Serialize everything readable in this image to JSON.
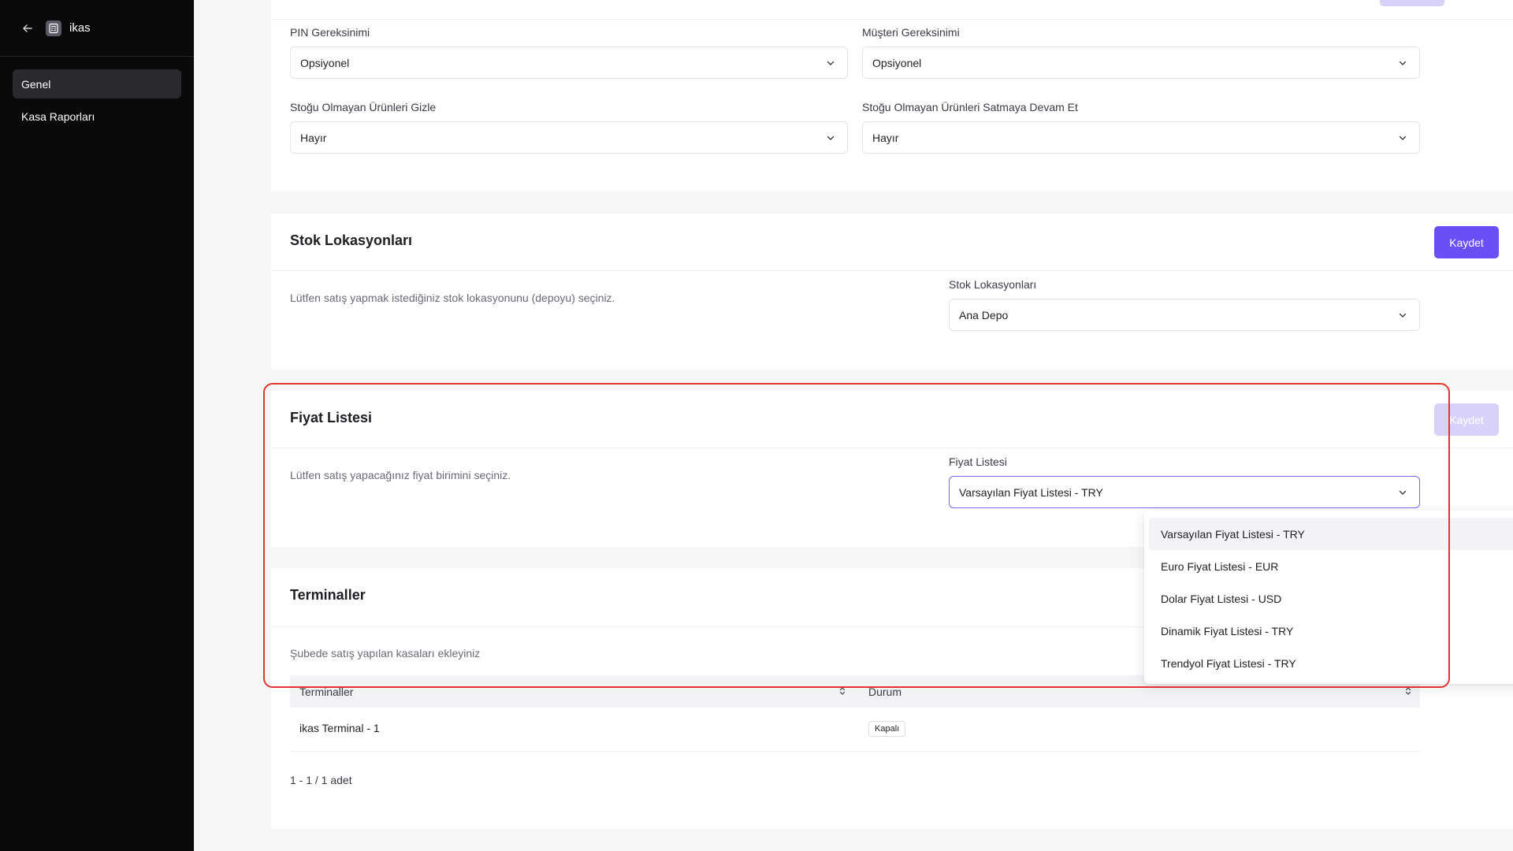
{
  "app": {
    "name": "ikas"
  },
  "sidebar": {
    "items": [
      {
        "label": "Genel",
        "active": true
      },
      {
        "label": "Kasa Raporları",
        "active": false
      }
    ]
  },
  "settings": {
    "pin": {
      "label": "PIN Gereksinimi",
      "value": "Opsiyonel"
    },
    "customer": {
      "label": "Müşteri Gereksinimi",
      "value": "Opsiyonel"
    },
    "hide_out_of_stock": {
      "label": "Stoğu Olmayan Ürünleri Gizle",
      "value": "Hayır"
    },
    "sell_out_of_stock": {
      "label": "Stoğu Olmayan Ürünleri Satmaya Devam Et",
      "value": "Hayır"
    }
  },
  "stock": {
    "title": "Stok Lokasyonları",
    "save_label": "Kaydet",
    "description": "Lütfen satış yapmak istediğiniz stok lokasyonunu (depoyu) seçiniz.",
    "field_label": "Stok Lokasyonları",
    "value": "Ana Depo"
  },
  "price_list": {
    "title": "Fiyat Listesi",
    "save_label": "Kaydet",
    "description": "Lütfen satış yapacağınız fiyat birimini seçiniz.",
    "field_label": "Fiyat Listesi",
    "value": "Varsayılan Fiyat Listesi - TRY",
    "options": [
      "Varsayılan Fiyat Listesi - TRY",
      "Euro Fiyat Listesi - EUR",
      "Dolar Fiyat Listesi - USD",
      "Dinamik Fiyat Listesi - TRY",
      "Trendyol Fiyat Listesi - TRY"
    ]
  },
  "terminals": {
    "title": "Terminaller",
    "description": "Şubede satış yapılan kasaları ekleyiniz",
    "columns": [
      "Terminaller",
      "Durum"
    ],
    "rows": [
      {
        "name": "ikas Terminal - 1",
        "status": "Kapalı"
      }
    ],
    "pagination": "1 - 1 / 1 adet"
  },
  "colors": {
    "accent": "#6b4ff6",
    "accent_disabled": "#d8d2fb",
    "highlight": "#e0362c",
    "sidebar_bg": "#0a0a0a"
  }
}
